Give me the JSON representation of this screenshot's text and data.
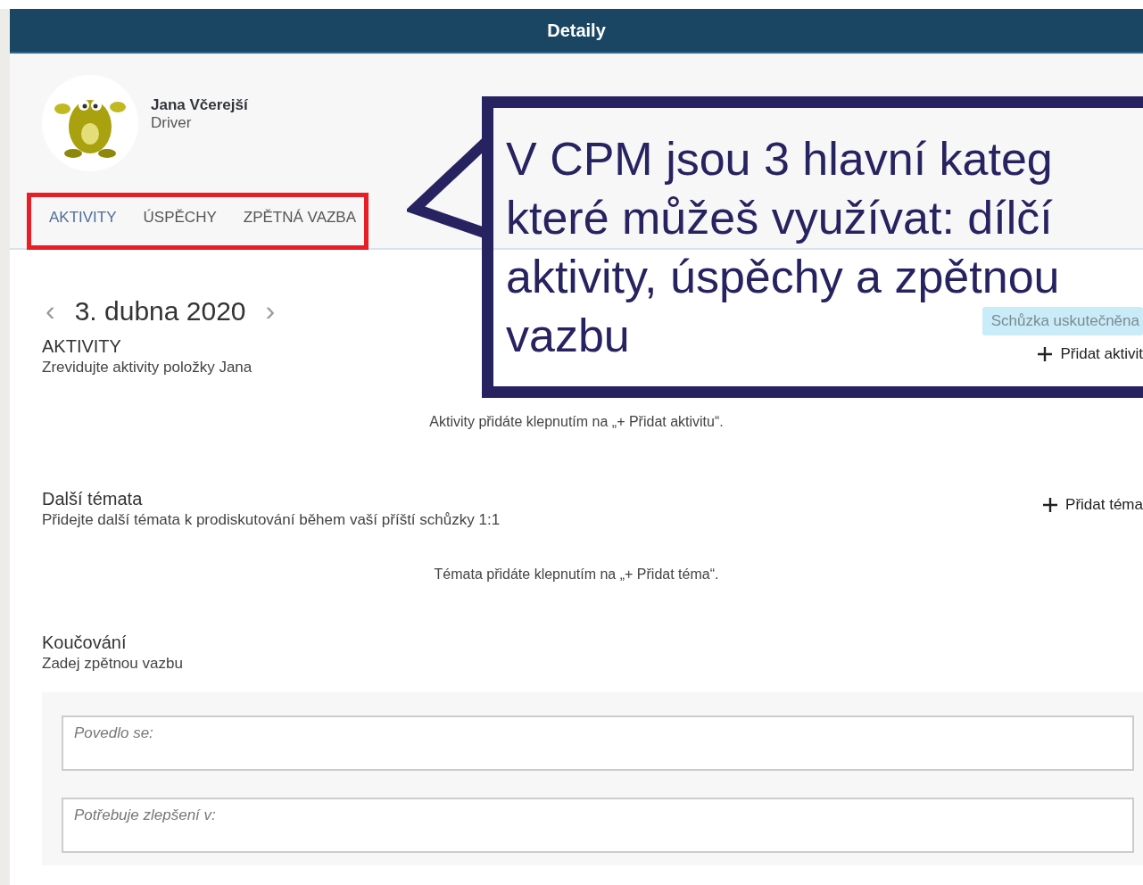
{
  "header": {
    "title": "Detaily"
  },
  "profile": {
    "name": "Jana Včerejší",
    "role": "Driver"
  },
  "tabs": [
    {
      "label": "AKTIVITY",
      "selected": true
    },
    {
      "label": "ÚSPĚCHY",
      "selected": false
    },
    {
      "label": "ZPĚTNÁ VAZBA",
      "selected": false
    }
  ],
  "meeting": {
    "date": "3. dubna 2020",
    "prev": "‹",
    "next": "›",
    "status": "Schůzka uskutečněna"
  },
  "sections": [
    {
      "title": "AKTIVITY",
      "subtitle": "Zrevidujte aktivity položky Jana",
      "add_label": "Přidat aktivit",
      "empty_text": "Aktivity přidáte klepnutím na „+ Přidat aktivitu“."
    },
    {
      "title": "Další témata",
      "subtitle": "Přidejte další témata k prodiskutování během vaší příští schůzky 1:1",
      "add_label": "Přidat téma",
      "empty_text": "Témata přidáte klepnutím na „+ Přidat téma“."
    }
  ],
  "coaching": {
    "title": "Koučování",
    "subtitle": "Zadej zpětnou vazbu",
    "fields": [
      {
        "placeholder": "Povedlo se:"
      },
      {
        "placeholder": "Potřebuje zlepšení v:"
      }
    ]
  },
  "callout": {
    "lines": [
      "V CPM jsou 3 hlavní kateg",
      "které můžeš využívat: dílčí",
      "aktivity, úspěchy a zpětnou",
      "vazbu"
    ]
  }
}
